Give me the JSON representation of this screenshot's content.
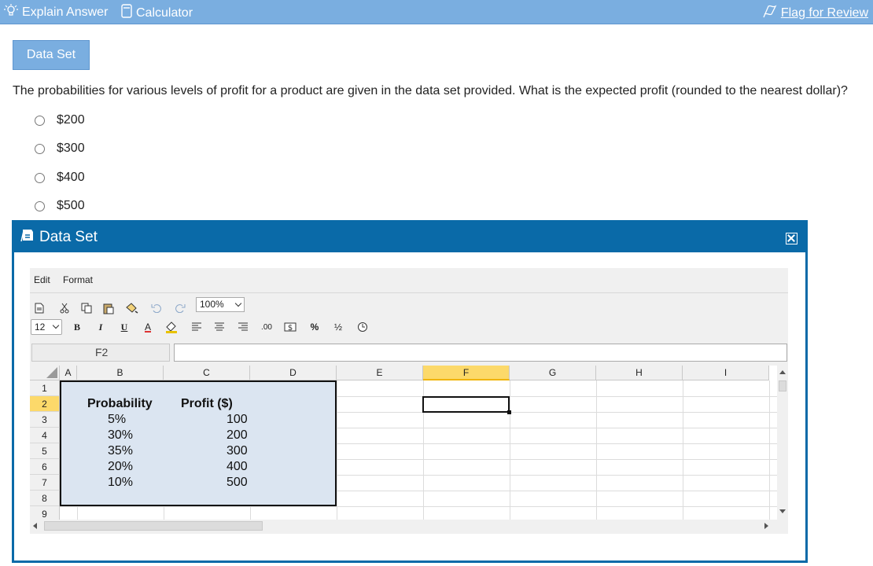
{
  "topbar": {
    "explain_label": "Explain Answer",
    "calculator_label": "Calculator",
    "flag_label": "Flag for Review"
  },
  "data_set_button": "Data Set",
  "question": "The probabilities for various levels of profit for a product are given in the data set provided. What is the expected profit (rounded to the nearest dollar)?",
  "options": [
    "$200",
    "$300",
    "$400",
    "$500"
  ],
  "dialog": {
    "title": "Data Set",
    "menu": [
      "Edit",
      "Format"
    ],
    "zoom": "100%",
    "font_size": "12",
    "name_box": "F2",
    "formula": "",
    "columns": [
      "A",
      "B",
      "C",
      "D",
      "E",
      "F",
      "G",
      "H",
      "I"
    ],
    "rows": [
      "1",
      "2",
      "3",
      "4",
      "5",
      "6",
      "7",
      "8",
      "9"
    ],
    "selected_cell": "F2",
    "toolbar_text": {
      "bold": "B",
      "italic": "I",
      "underline": "U",
      "font_color": "A",
      "decimals": ".00",
      "percent": "%",
      "fraction": "½"
    },
    "table": {
      "headers": [
        "Probability",
        "Profit ($)"
      ],
      "probability": [
        "5%",
        "30%",
        "35%",
        "20%",
        "10%"
      ],
      "profit": [
        "100",
        "200",
        "300",
        "400",
        "500"
      ]
    }
  },
  "colors": {
    "topbar": "#7aaee0",
    "dialog_header": "#0a6aa8",
    "data_fill": "#dbe5f1",
    "selected_header": "#fcd96a"
  }
}
